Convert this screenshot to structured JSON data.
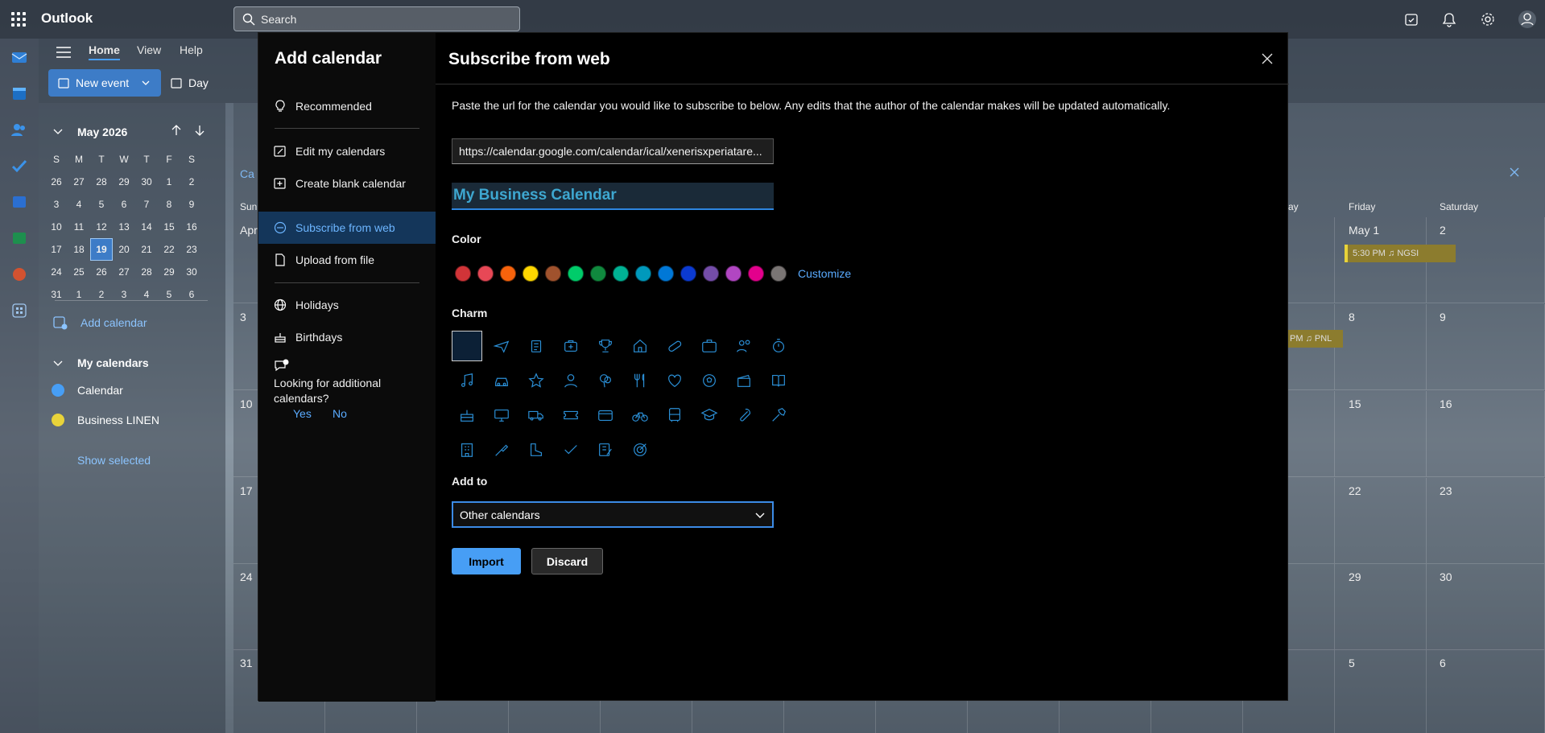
{
  "app": {
    "title": "Outlook"
  },
  "search": {
    "placeholder": "Search"
  },
  "ribbon": {
    "tabs": [
      "Home",
      "View",
      "Help"
    ],
    "new_event": "New event",
    "day": "Day"
  },
  "mini_calendar": {
    "month": "May 2026",
    "weekdays": [
      "S",
      "M",
      "T",
      "W",
      "T",
      "F",
      "S"
    ],
    "weeks": [
      [
        "26",
        "27",
        "28",
        "29",
        "30",
        "1",
        "2"
      ],
      [
        "3",
        "4",
        "5",
        "6",
        "7",
        "8",
        "9"
      ],
      [
        "10",
        "11",
        "12",
        "13",
        "14",
        "15",
        "16"
      ],
      [
        "17",
        "18",
        "19",
        "20",
        "21",
        "22",
        "23"
      ],
      [
        "24",
        "25",
        "26",
        "27",
        "28",
        "29",
        "30"
      ],
      [
        "31",
        "1",
        "2",
        "3",
        "4",
        "5",
        "6"
      ]
    ],
    "today": "19"
  },
  "left_pane": {
    "add_calendar": "Add calendar",
    "my_calendars": "My calendars",
    "calendars": [
      {
        "name": "Calendar",
        "color": "#479ef5"
      },
      {
        "name": "Business LINEN",
        "color": "#e8d33a"
      }
    ],
    "show_selected": "Show selected"
  },
  "calendar_grid": {
    "headers": [
      "Sunday",
      "Friday",
      "Saturday"
    ],
    "header_partial": "ay",
    "header_partial_left": "Sun",
    "days_left": [
      "Apr",
      "3",
      "10",
      "17",
      "24",
      "31"
    ],
    "days_fri": [
      "May 1",
      "8",
      "15",
      "22",
      "29",
      "5"
    ],
    "days_sat": [
      "2",
      "9",
      "16",
      "23",
      "30",
      "6"
    ],
    "event1": "5:30 PM ♫ NGSI",
    "event2": "PM ♫ PNL",
    "banner_partial": "Ca"
  },
  "modal": {
    "title": "Add calendar",
    "nav": [
      {
        "label": "Recommended",
        "icon": "lightbulb-icon"
      },
      {
        "label": "Edit my calendars",
        "icon": "edit-calendar-icon"
      },
      {
        "label": "Create blank calendar",
        "icon": "add-calendar-icon"
      },
      {
        "label": "Subscribe from web",
        "icon": "globe-link-icon"
      },
      {
        "label": "Upload from file",
        "icon": "file-icon"
      },
      {
        "label": "Holidays",
        "icon": "globe-icon"
      },
      {
        "label": "Birthdays",
        "icon": "cake-icon"
      }
    ],
    "looking": "Looking for additional calendars?",
    "yes": "Yes",
    "no": "No",
    "header": "Subscribe from web",
    "description": "Paste the url for the calendar you would like to subscribe to below. Any edits that the author of the calendar makes will be updated automatically.",
    "url": "https://calendar.google.com/calendar/ical/xenerisxperiatare...",
    "calendar_name": "My Business Calendar",
    "color_label": "Color",
    "colors": [
      "#d13438",
      "#e74856",
      "#f7630c",
      "#ffd700",
      "#a0522d",
      "#00cc6a",
      "#10893e",
      "#00b294",
      "#0099bc",
      "#0078d7",
      "#0b3ad1",
      "#744da9",
      "#b146c2",
      "#e3008c",
      "#7a7574"
    ],
    "customize": "Customize",
    "charm_label": "Charm",
    "charms": [
      "none",
      "airplane-icon",
      "clipboard-icon",
      "medical-bag-icon",
      "trophy-icon",
      "home-icon",
      "pill-icon",
      "briefcase-icon",
      "people-icon",
      "timer-icon",
      "music-note-icon",
      "car-icon",
      "star-icon",
      "person-icon",
      "balloon-icon",
      "utensils-icon",
      "heart-icon",
      "soccer-ball-icon",
      "movie-clapper-icon",
      "book-icon",
      "cake-icon",
      "monitor-icon",
      "truck-icon",
      "ticket-icon",
      "credit-card-icon",
      "bicycle-icon",
      "bus-icon",
      "graduation-cap-icon",
      "wrench-icon",
      "hammer-icon",
      "building-icon",
      "screwdriver-icon",
      "hiking-boot-icon",
      "checkmark-icon",
      "note-pencil-icon",
      "target-icon"
    ],
    "add_to_label": "Add to",
    "add_to_value": "Other calendars",
    "import": "Import",
    "discard": "Discard"
  }
}
